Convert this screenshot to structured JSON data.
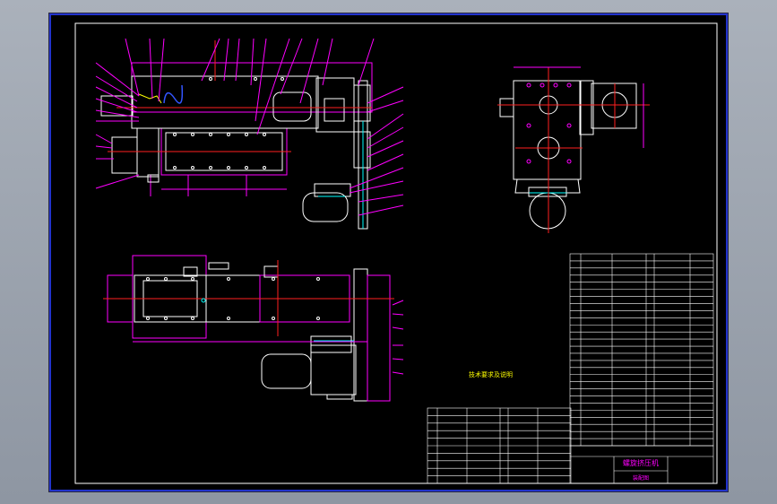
{
  "drawing": {
    "background": "#000000",
    "colors": {
      "border": "#3344ff",
      "outline": "#ffffff",
      "frame": "#ff00ff",
      "centerline": "#ff2020",
      "leader": "#ff00ff",
      "accent": "#00ffff",
      "pipe": "#3355ff",
      "note": "#ffff00",
      "table_text": "#ff00ff"
    },
    "note": "技术要求及说明",
    "parts_table": {
      "right_rows": 27,
      "left_rows": 10
    },
    "title_block": {
      "title": "螺旋挤压机",
      "subtitle": "装配图"
    }
  }
}
